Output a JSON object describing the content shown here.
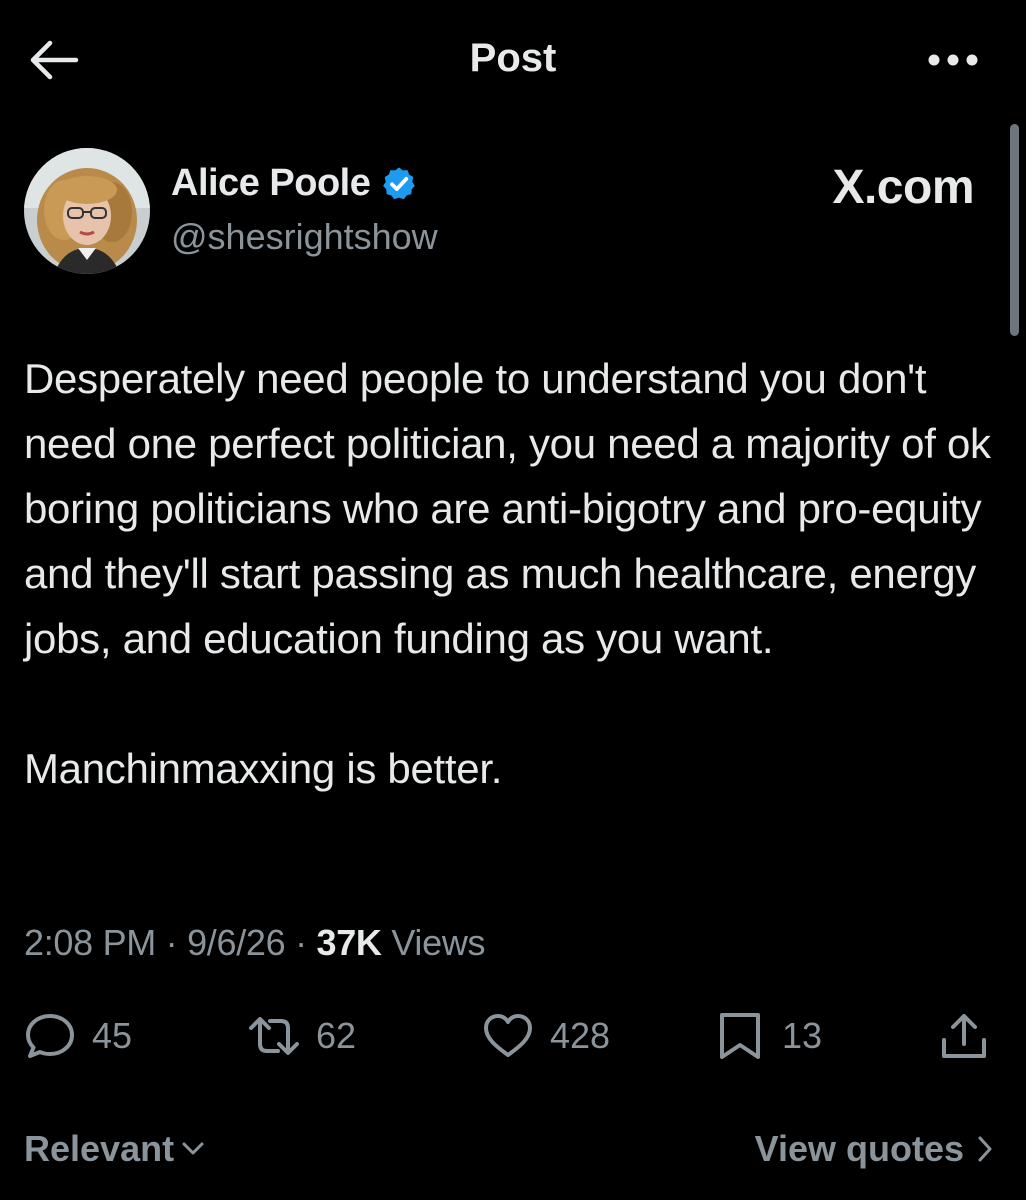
{
  "header": {
    "title": "Post"
  },
  "author": {
    "name": "Alice Poole",
    "handle": "@shesrightshow",
    "verified": true,
    "badge_color": "#1d9bf0"
  },
  "watermark": "X.com",
  "post": {
    "paragraphs": [
      "Desperately need people to understand you don't need one perfect politician, you need a majority of ok boring politicians who are anti-bigotry and pro-equity and they'll start passing as much healthcare, energy jobs, and education funding as you want.",
      "Manchinmaxxing is better."
    ]
  },
  "meta": {
    "time": "2:08 PM",
    "separator": "·",
    "date": "9/6/26",
    "views_count": "37K",
    "views_label": "Views"
  },
  "actions": {
    "replies": "45",
    "reposts": "62",
    "likes": "428",
    "bookmarks": "13"
  },
  "footer": {
    "sort_label": "Relevant",
    "view_quotes_label": "View quotes"
  },
  "icons": {
    "back": "arrow-left-icon",
    "more": "more-horizontal-icon",
    "reply": "speech-bubble-icon",
    "repost": "repost-icon",
    "like": "heart-icon",
    "bookmark": "bookmark-icon",
    "share": "share-upload-icon"
  }
}
